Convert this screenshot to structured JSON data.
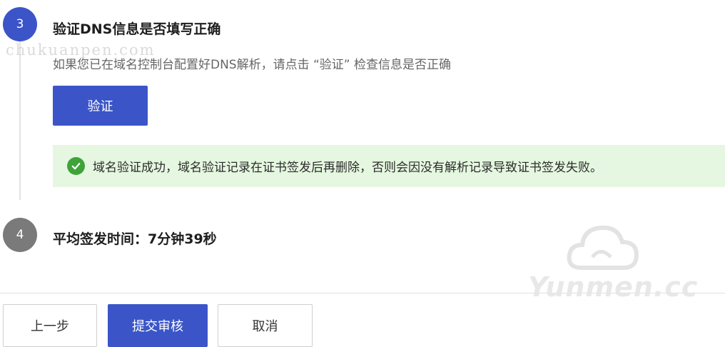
{
  "steps": [
    {
      "number": "3",
      "title": "验证DNS信息是否填写正确",
      "description": "如果您已在域名控制台配置好DNS解析，请点击 “验证” 检查信息是否正确",
      "button_label": "验证",
      "alert": {
        "text": "域名验证成功，域名验证记录在证书签发后再删除，否则会因没有解析记录导致证书签发失败。",
        "icon": "check-circle-icon",
        "color": "#3fa33a"
      }
    },
    {
      "number": "4",
      "title": "平均签发时间：7分钟39秒"
    }
  ],
  "footer": {
    "prev_label": "上一步",
    "submit_label": "提交审核",
    "cancel_label": "取消"
  },
  "watermarks": {
    "top": "chukuanpen.com",
    "bottom": "Yunmen.cc"
  },
  "colors": {
    "primary": "#3b55c8",
    "inactive_step": "#7a7a7a",
    "success_bg": "#e5f7e0",
    "success_icon": "#3fa33a"
  }
}
